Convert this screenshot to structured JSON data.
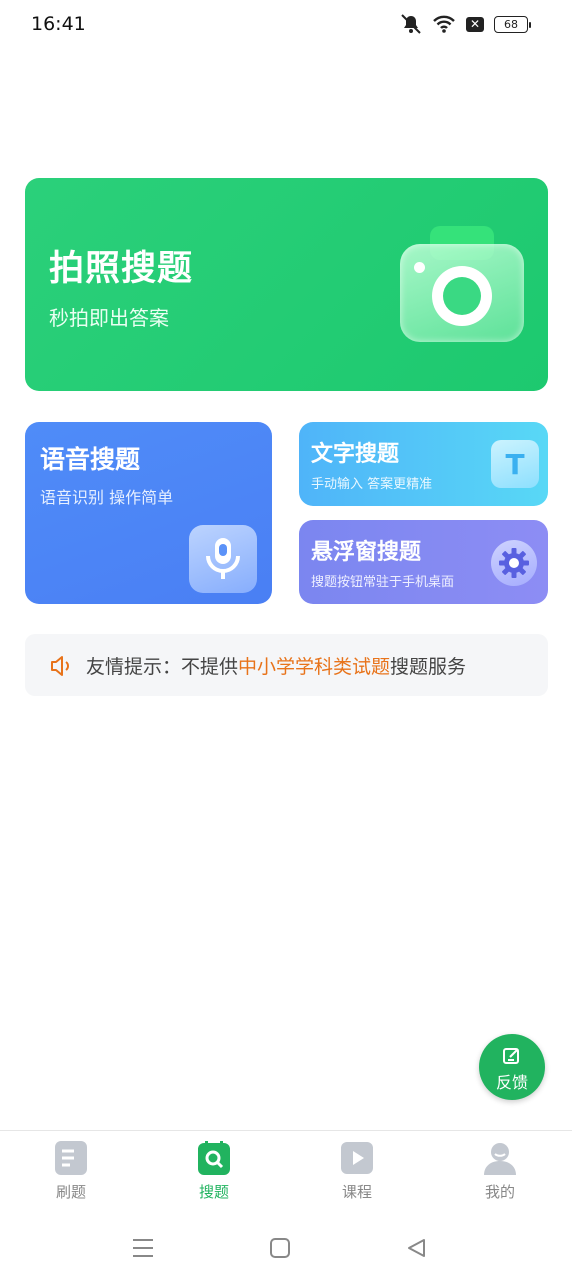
{
  "status_bar": {
    "time": "16:41",
    "battery": "68",
    "icons": [
      "mute-bell-icon",
      "wifi-icon",
      "sim-off-icon",
      "battery-icon"
    ]
  },
  "photo_search": {
    "title": "拍照搜题",
    "subtitle": "秒拍即出答案",
    "icon": "camera-icon"
  },
  "voice_search": {
    "title": "语音搜题",
    "subtitle": "语音识别 操作简单",
    "icon": "microphone-icon"
  },
  "text_search": {
    "title": "文字搜题",
    "subtitle": "手动输入 答案更精准",
    "icon_letter": "T"
  },
  "float_search": {
    "title": "悬浮窗搜题",
    "subtitle": "搜题按钮常驻于手机桌面",
    "icon": "gear-icon"
  },
  "notice": {
    "prefix": "友情提示：不提供",
    "highlight": "中小学学科类试题",
    "suffix": "搜题服务",
    "highlight_color": "#e8731a"
  },
  "feedback": {
    "label": "反馈"
  },
  "tabs": [
    {
      "label": "刷题",
      "icon": "document-icon",
      "active": false
    },
    {
      "label": "搜题",
      "icon": "search-icon",
      "active": true
    },
    {
      "label": "课程",
      "icon": "play-icon",
      "active": false
    },
    {
      "label": "我的",
      "icon": "user-icon",
      "active": false
    }
  ],
  "colors": {
    "accent": "#21b35f",
    "photo_card": "#22cc72",
    "voice_card": "#4d86f6",
    "text_card": "#52c4f8",
    "float_card": "#8289f2"
  }
}
